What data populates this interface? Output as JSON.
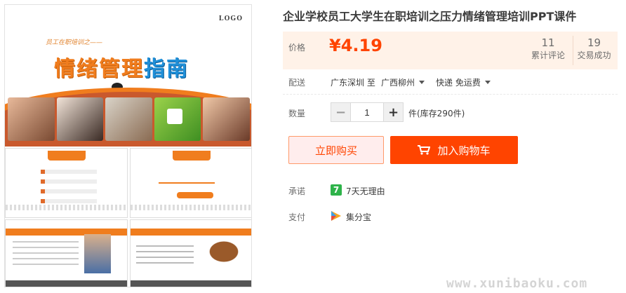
{
  "product": {
    "title": "企业学校员工大学生在职培训之压力情绪管理培训PPT课件"
  },
  "image": {
    "logo": "LOGO",
    "cover_subtitle": "员工在职培训之——",
    "cover_title_orange": "情绪管理",
    "cover_title_blue": "指南"
  },
  "price": {
    "label": "价格",
    "value": "¥4.19"
  },
  "stats": {
    "reviews_count": "11",
    "reviews_label": "累计评论",
    "sales_count": "19",
    "sales_label": "交易成功"
  },
  "shipping": {
    "label": "配送",
    "from": "广东深圳 至",
    "to": "广西柳州",
    "method": "快递 免运费"
  },
  "quantity": {
    "label": "数量",
    "value": "1",
    "minus": "−",
    "plus": "+",
    "stock": "件(库存290件)"
  },
  "actions": {
    "buy_now": "立即购买",
    "add_cart": "加入购物车"
  },
  "promise": {
    "label": "承诺",
    "icon_char": "7",
    "text": "7天无理由"
  },
  "payment": {
    "label": "支付",
    "text": "集分宝"
  },
  "watermark": "www.xunibaoku.com",
  "colors": {
    "accent": "#ff4400",
    "price_bg": "#fff2e8",
    "promise_green": "#2eb34a"
  }
}
